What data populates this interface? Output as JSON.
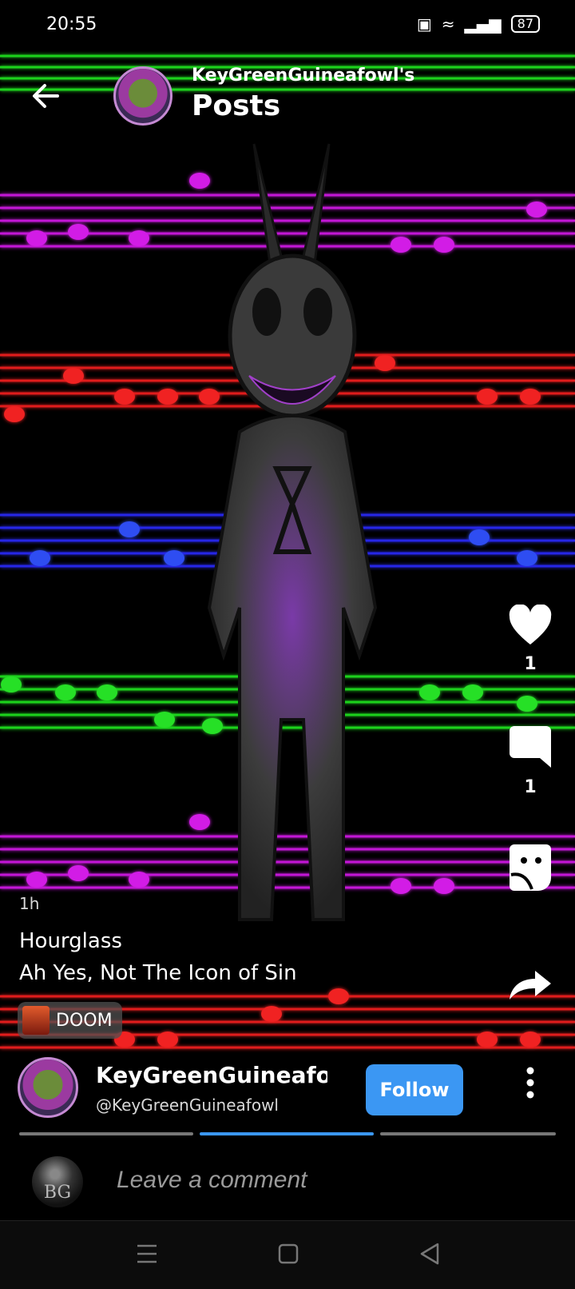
{
  "status_bar": {
    "time": "20:55",
    "nfc_icon": "nfc-icon",
    "wifi_icon": "wifi-icon",
    "signal_icon": "signal-icon",
    "battery": "87"
  },
  "header": {
    "user_label": "KeyGreenGuineafowl's",
    "title": "Posts",
    "back_icon": "back-arrow-icon"
  },
  "actions": {
    "like_count": "1",
    "comment_count": "1",
    "like_icon": "heart-icon",
    "comment_icon": "comment-bubble-icon",
    "sticker_icon": "sticker-icon",
    "share_icon": "share-arrow-icon"
  },
  "post": {
    "time": "1h",
    "title": "Hourglass",
    "body": "Ah Yes, Not The Icon of Sin",
    "tag": "DOOM"
  },
  "author": {
    "name": "KeyGreenGuineafowl",
    "handle": "@KeyGreenGuineafowl",
    "follow_label": "Follow"
  },
  "comment": {
    "placeholder": "Leave a comment",
    "avatar_text": "BG"
  },
  "nav": {
    "menu_icon": "menu-icon",
    "home_icon": "home-square-icon",
    "back_icon": "back-triangle-icon"
  },
  "colors": {
    "accent": "#3b97f3",
    "staff_green": "#1fd21f",
    "staff_purple": "#c316d6",
    "staff_red": "#e01a1a",
    "staff_blue": "#2626e6"
  }
}
